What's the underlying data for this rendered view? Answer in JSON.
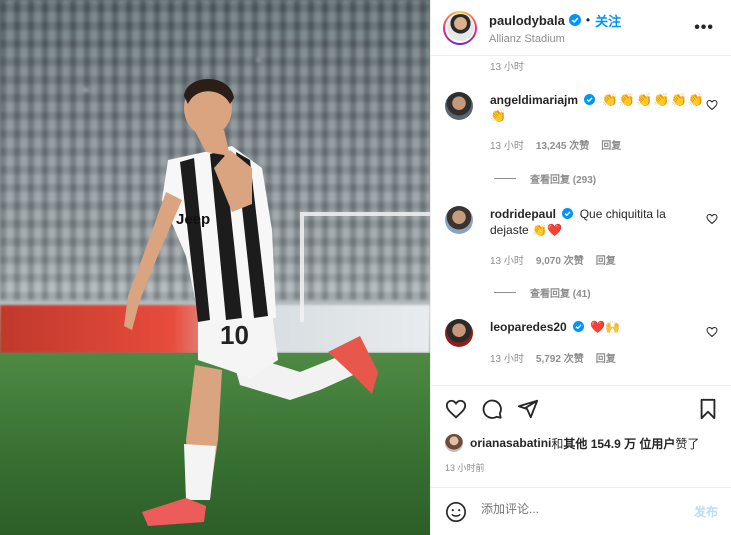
{
  "post": {
    "username": "paulodybala",
    "dot": "•",
    "follow_label": "关注",
    "location": "Allianz Stadium",
    "more": "•••"
  },
  "time_top": "13 小时",
  "comments": [
    {
      "username": "angeldimariajm",
      "text": "👏👏👏👏👏👏👏",
      "time": "13 小时",
      "likes": "13,245 次赞",
      "reply": "回复",
      "view_replies": "查看回复 (293)"
    },
    {
      "username": "rodridepaul",
      "text": "Que chiquitita la dejaste 👏❤️",
      "time": "13 小时",
      "likes": "9,070 次赞",
      "reply": "回复",
      "view_replies": "查看回复 (41)"
    },
    {
      "username": "leoparedes20",
      "text": "❤️🙌",
      "time": "13 小时",
      "likes": "5,792 次赞",
      "reply": "回复"
    }
  ],
  "likes": {
    "user": "orianasabatini",
    "and": " 和 ",
    "others": "其他 154.9 万 位用户",
    "suffix": " 赞了"
  },
  "post_time": "13 小时前",
  "add_comment": {
    "placeholder": "添加评论...",
    "post_label": "发布"
  },
  "colors": {
    "accent": "#0095f6",
    "verified": "#0095f6",
    "heart": "#ed4956"
  }
}
